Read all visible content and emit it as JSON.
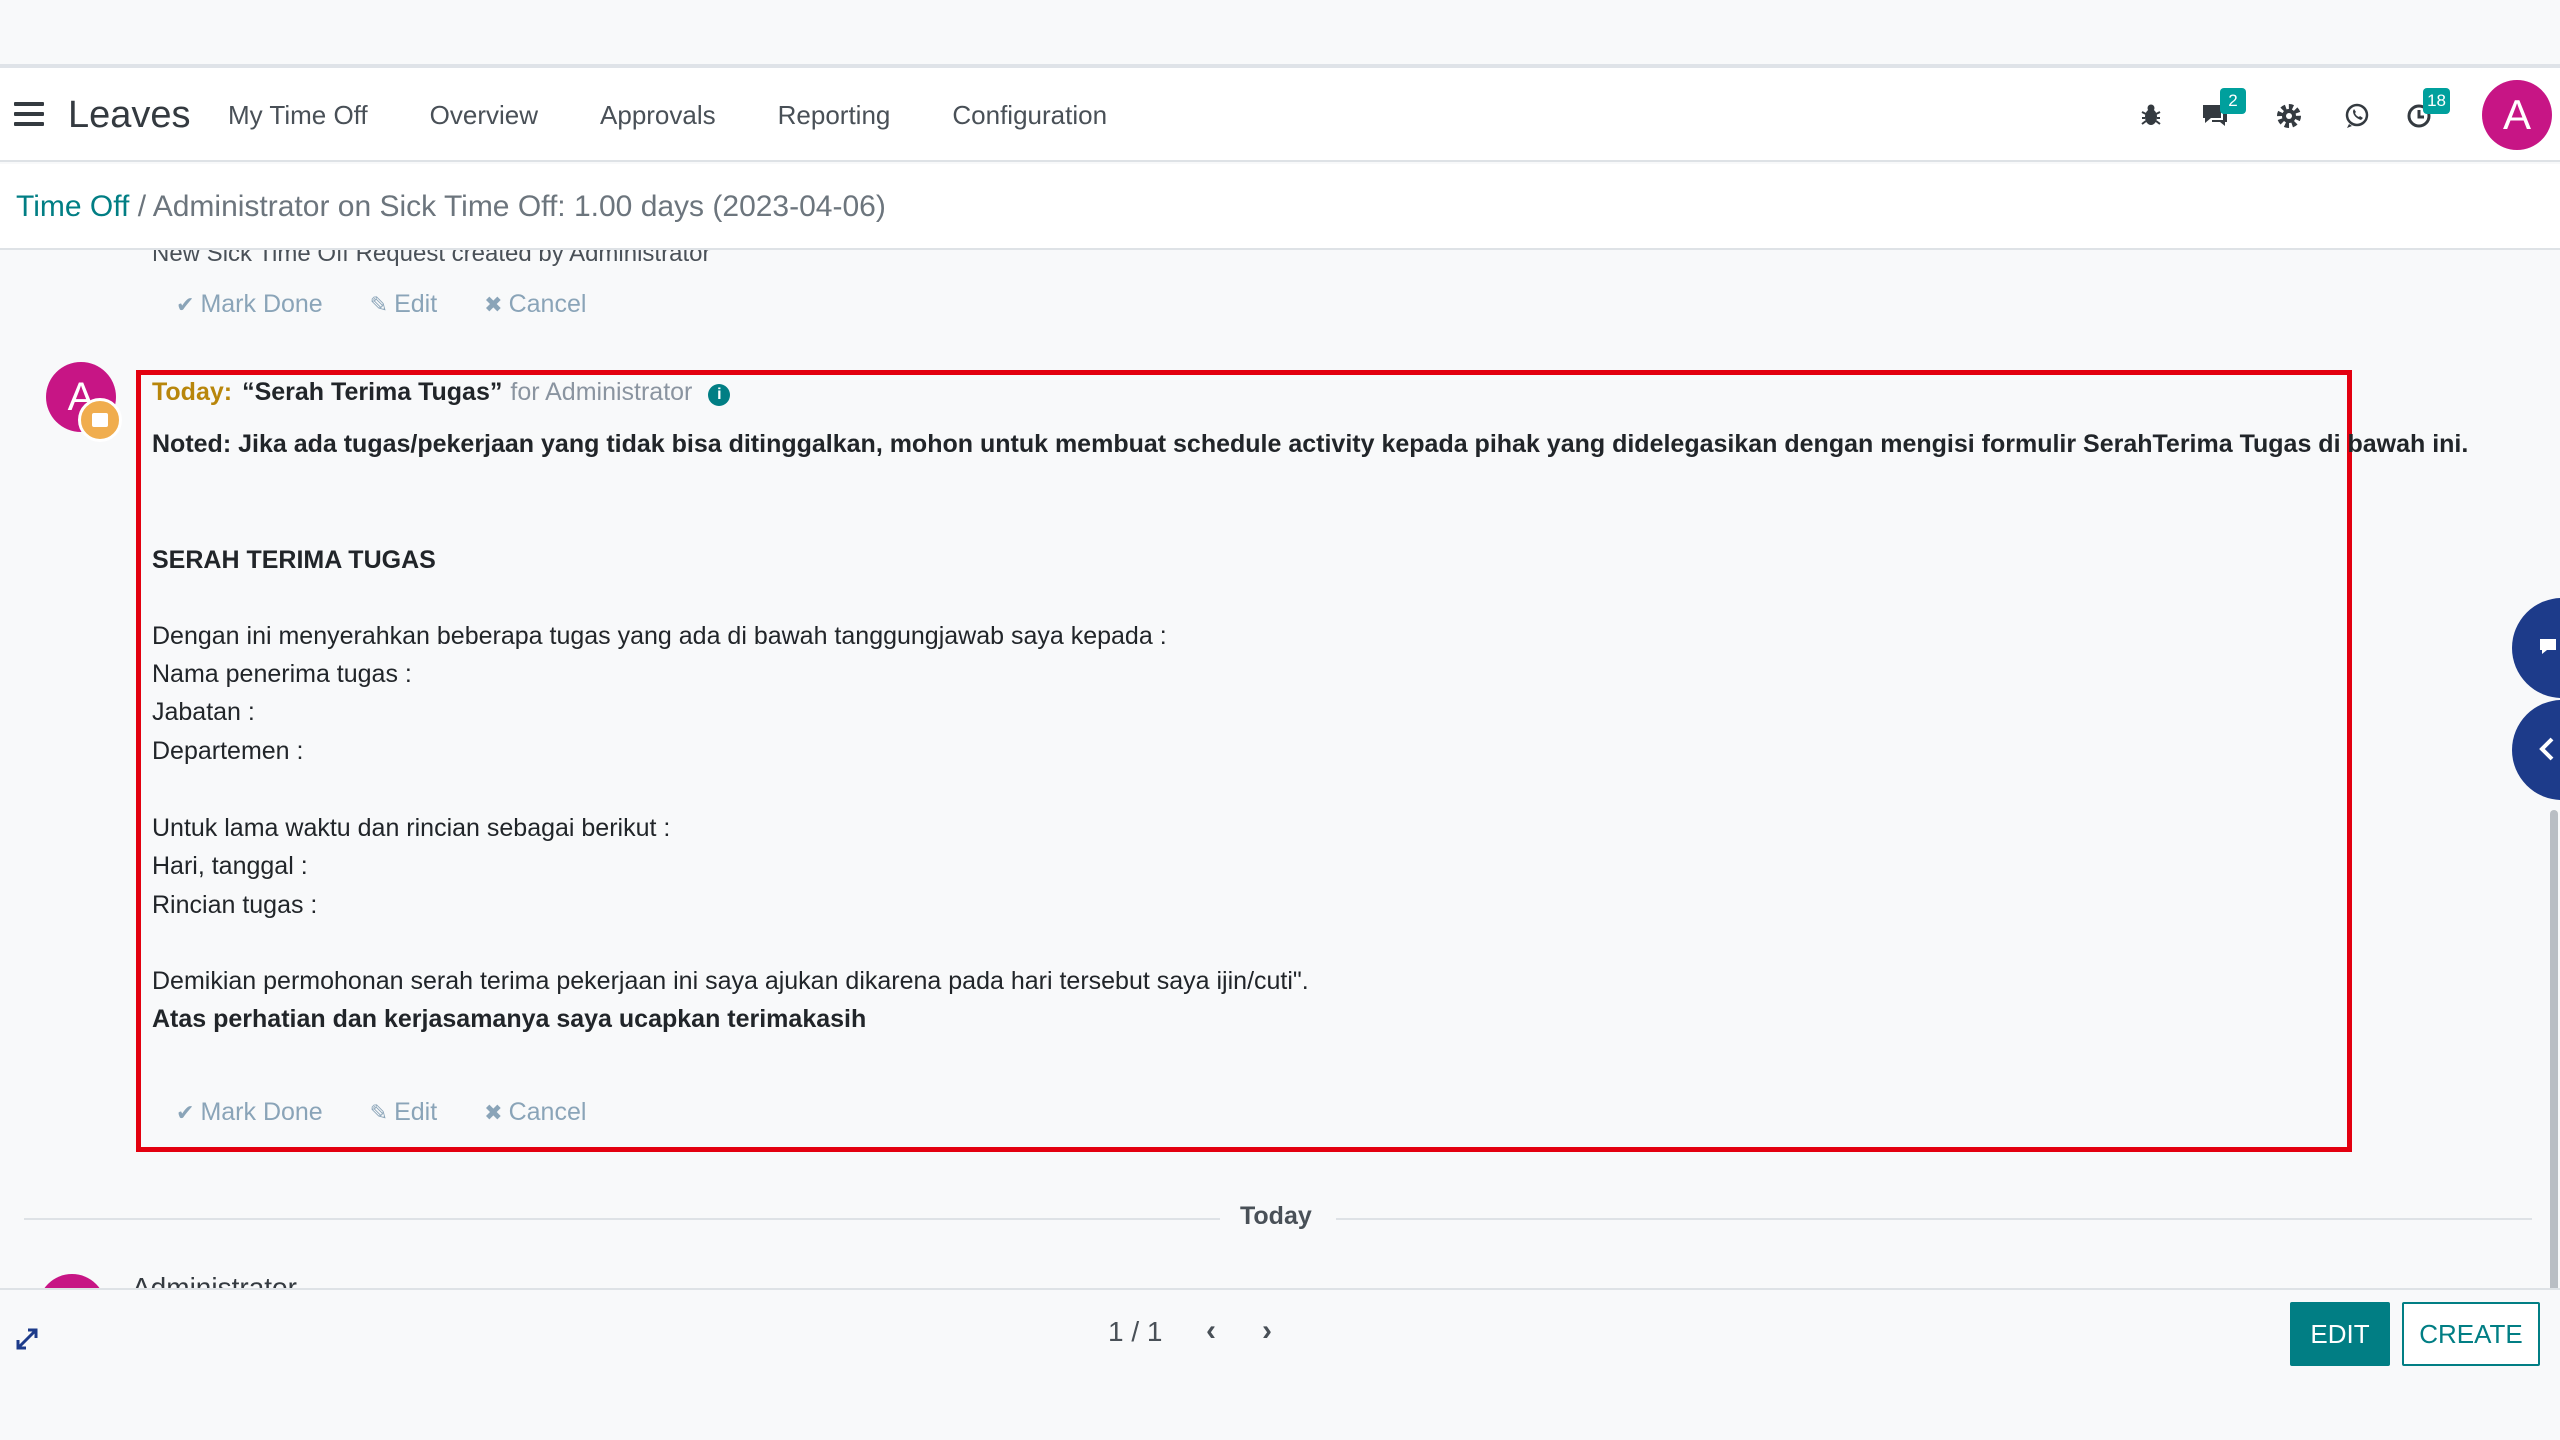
{
  "navbar": {
    "app_title": "Leaves",
    "menu": [
      "My Time Off",
      "Overview",
      "Approvals",
      "Reporting",
      "Configuration"
    ],
    "messages_badge": "2",
    "activities_badge": "18",
    "avatar_letter": "A"
  },
  "breadcrumb": {
    "root": "Time Off",
    "separator": " / ",
    "current": "Administrator on Sick Time Off: 1.00 days (2023-04-06)"
  },
  "chatter": {
    "previous_message": "New Sick Time Off Request created by Administrator",
    "actions": {
      "mark_done": "Mark Done",
      "edit": "Edit",
      "cancel": "Cancel"
    },
    "activity": {
      "avatar_letter": "A",
      "when": "Today:",
      "summary": "“Serah Terima Tugas”",
      "for_user": "for Administrator",
      "note": "Noted: Jika ada tugas/pekerjaan yang tidak bisa ditinggalkan, mohon untuk membuat schedule activity kepada pihak yang didelegasikan dengan mengisi formulir SerahTerima Tugas di bawah ini.",
      "heading": "SERAH TERIMA TUGAS",
      "line1": "Dengan ini menyerahkan beberapa tugas yang ada di bawah tanggungjawab saya kepada :",
      "line2": "Nama penerima tugas :",
      "line3": "Jabatan :",
      "line4": "Departemen :",
      "line5": "Untuk lama waktu dan rincian sebagai berikut :",
      "line6": "Hari, tanggal :",
      "line7": "Rincian tugas :",
      "line8": "Demikian permohonan serah terima pekerjaan ini saya ajukan dikarena pada hari tersebut saya ijin/cuti\".",
      "line9": "Atas perhatian dan kerjasamanya saya ucapkan terimakasih"
    },
    "divider_label": "Today",
    "next_author_partial": "Administrator"
  },
  "footer": {
    "pager": "1 / 1",
    "edit_label": "EDIT",
    "create_label": "CREATE"
  },
  "colors": {
    "brand": "#017e84",
    "avatar": "#c71585",
    "highlight_border": "#e3000f",
    "activity_date": "#b8860b"
  }
}
